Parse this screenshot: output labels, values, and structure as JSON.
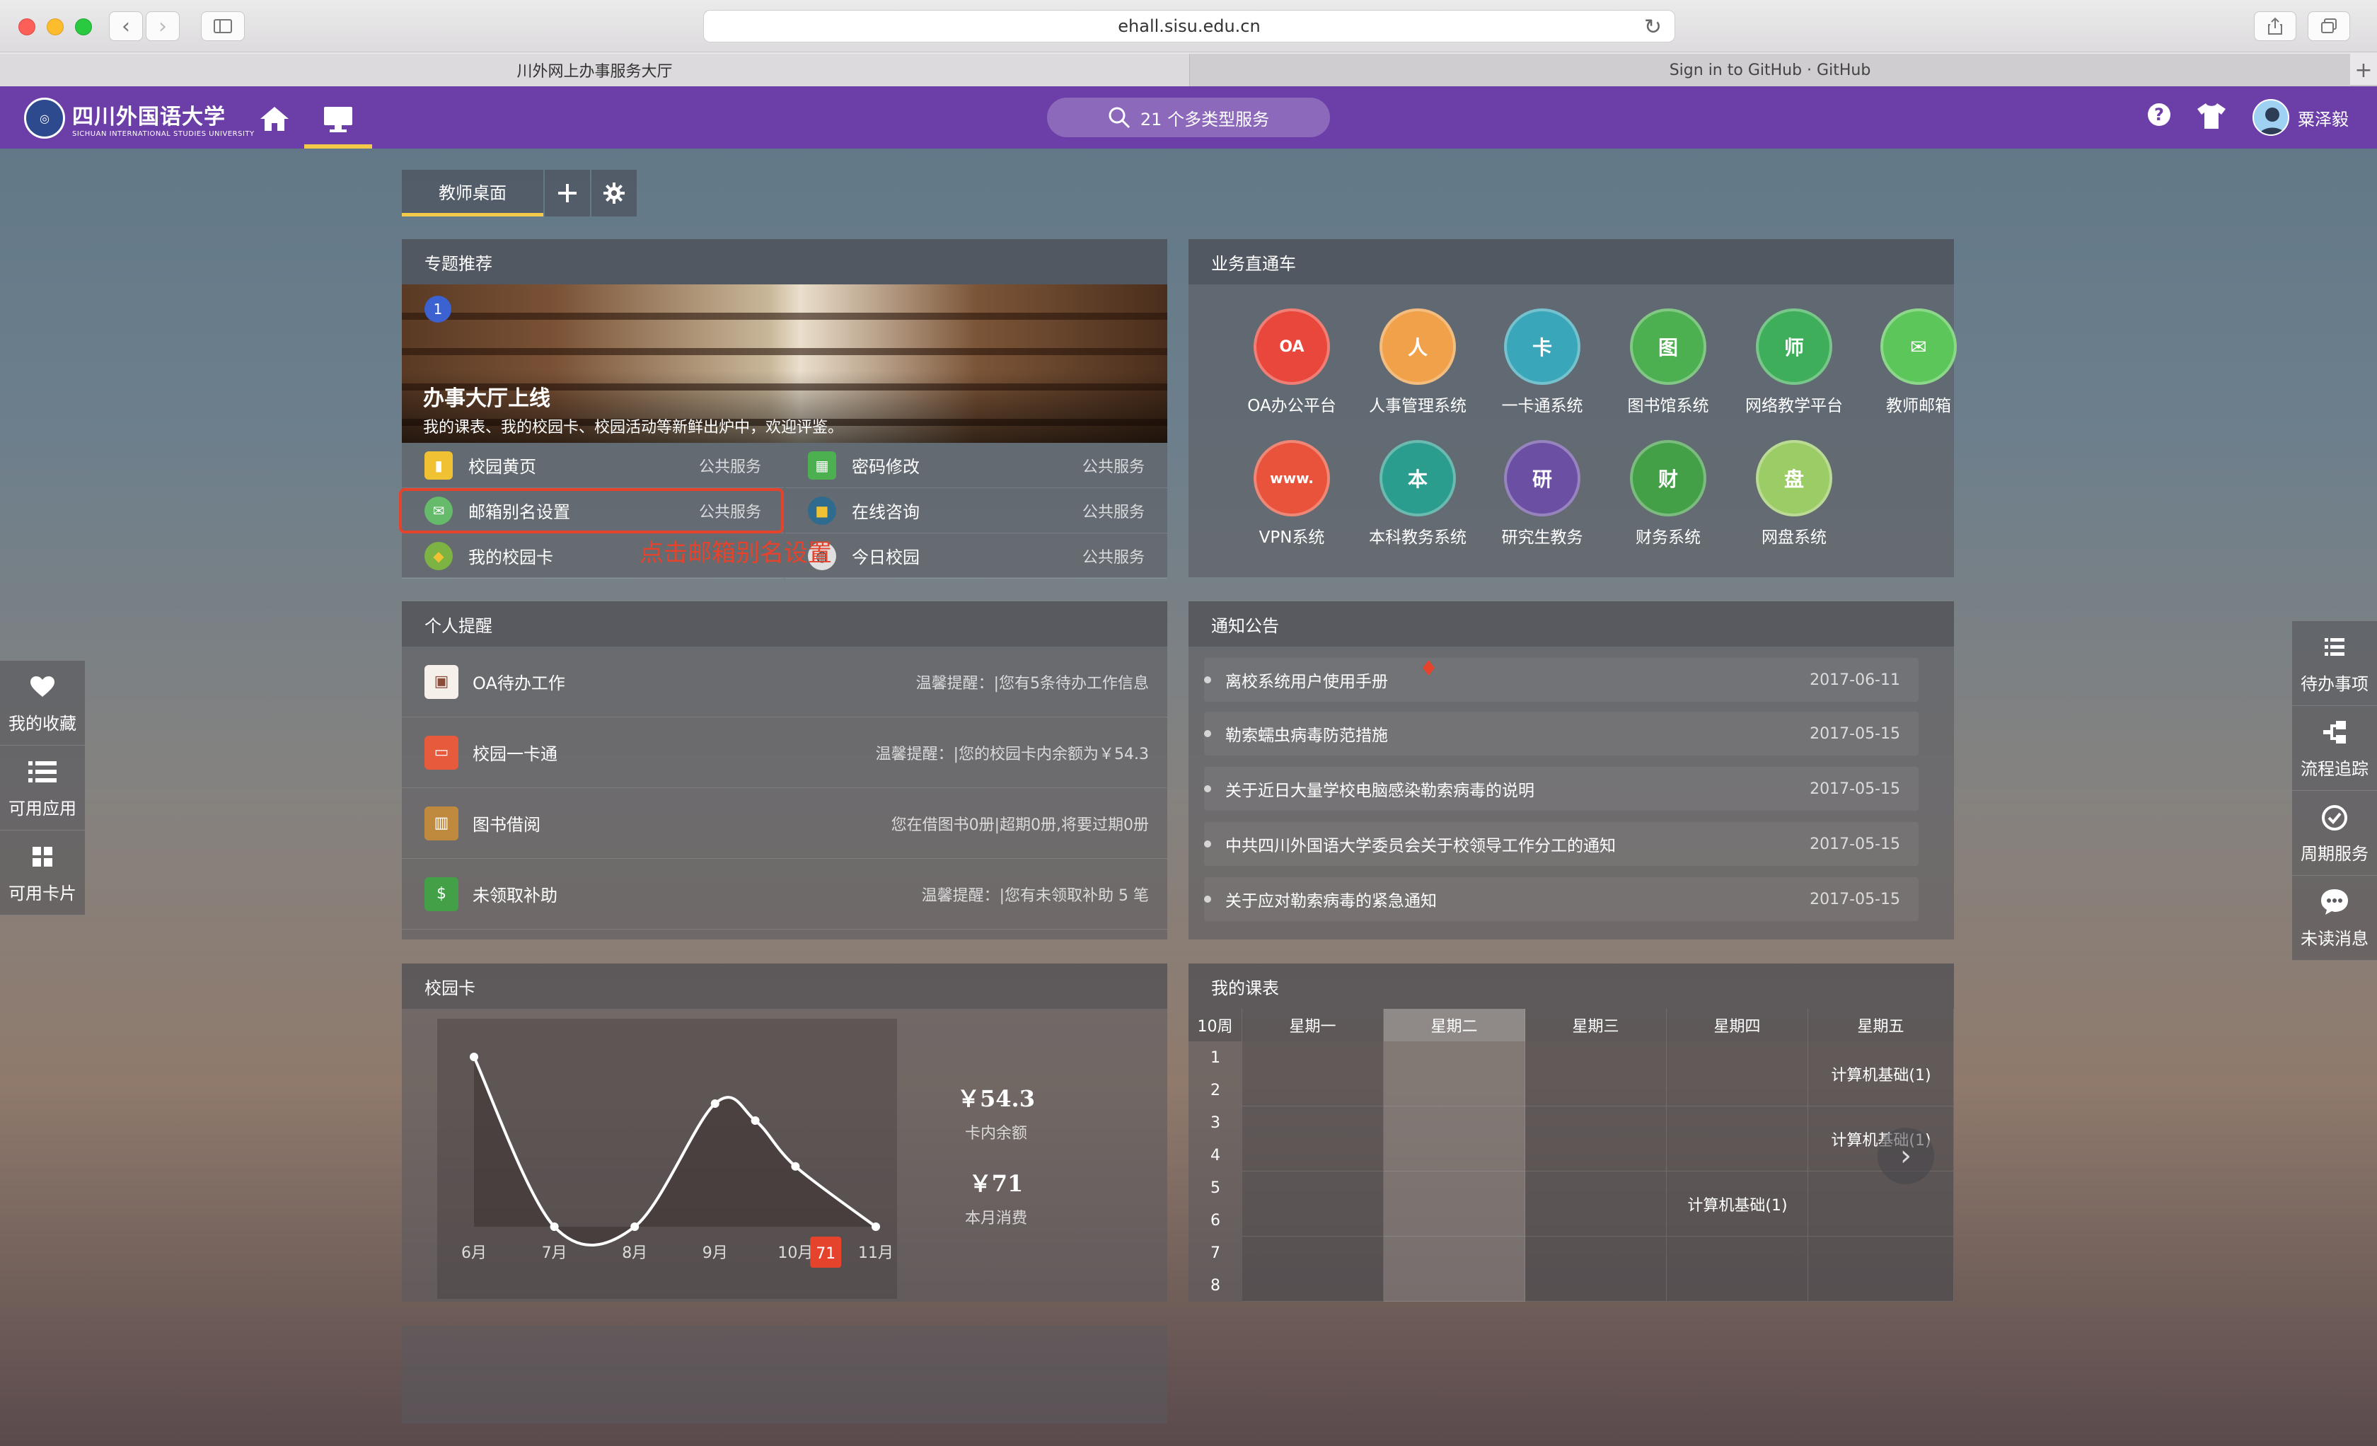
{
  "browser": {
    "url": "ehall.sisu.edu.cn",
    "tabs": [
      {
        "label": "川外网上办事服务大厅"
      },
      {
        "label": "Sign in to GitHub · GitHub"
      }
    ]
  },
  "header": {
    "logo_cn": "四川外国语大学",
    "logo_en": "SICHUAN INTERNATIONAL STUDIES UNIVERSITY",
    "search_label": "21 个多类型服务",
    "user_name": "粟泽毅",
    "accent": "#6c3fa8",
    "active_indicator": "#f3c94a"
  },
  "desktop": {
    "tab_label": "教师桌面"
  },
  "topics": {
    "title": "专题推荐",
    "banner": {
      "index": "1",
      "title": "办事大厅上线",
      "subtitle": "我的课表、我的校园卡、校园活动等新鲜出炉中，欢迎评鉴。"
    },
    "services": [
      {
        "name": "校园黄页",
        "tag": "公共服务",
        "icon": "yellow-pages-icon",
        "color": "#f0c233"
      },
      {
        "name": "密码修改",
        "tag": "公共服务",
        "icon": "password-icon",
        "color": "#4caf50"
      },
      {
        "name": "邮箱别名设置",
        "tag": "公共服务",
        "icon": "mail-alias-icon",
        "color": "#66bb6a"
      },
      {
        "name": "在线咨询",
        "tag": "公共服务",
        "icon": "chat-icon",
        "color": "#2e6b8f"
      },
      {
        "name": "我的校园卡",
        "tag": "",
        "icon": "campus-card-icon",
        "color": "#7cb342"
      },
      {
        "name": "今日校园",
        "tag": "公共服务",
        "icon": "today-campus-icon",
        "color": "#e0e0e0"
      }
    ],
    "annotation": "点击邮箱别名设置"
  },
  "business": {
    "title": "业务直通车",
    "apps": [
      {
        "name": "OA办公平台",
        "icon": "oa-icon",
        "color": "#e9473b",
        "glyph": "OA"
      },
      {
        "name": "人事管理系统",
        "icon": "hr-icon",
        "color": "#f0a14a",
        "glyph": "人"
      },
      {
        "name": "一卡通系统",
        "icon": "card-system-icon",
        "color": "#3aa6b9",
        "glyph": "卡"
      },
      {
        "name": "图书馆系统",
        "icon": "library-icon",
        "color": "#4caf50",
        "glyph": "图"
      },
      {
        "name": "网络教学平台",
        "icon": "teaching-platform-icon",
        "color": "#3fae5a",
        "glyph": "师"
      },
      {
        "name": "教师邮箱",
        "icon": "teacher-mail-icon",
        "color": "#5cc65a",
        "glyph": "✉"
      },
      {
        "name": "VPN系统",
        "icon": "vpn-icon",
        "color": "#e9533b",
        "glyph": "www."
      },
      {
        "name": "本科教务系统",
        "icon": "undergrad-affairs-icon",
        "color": "#2a9d8f",
        "glyph": "本"
      },
      {
        "name": "研究生教务",
        "icon": "graduate-affairs-icon",
        "color": "#6a4fa3",
        "glyph": "研"
      },
      {
        "name": "财务系统",
        "icon": "finance-icon",
        "color": "#43a047",
        "glyph": "财"
      },
      {
        "name": "网盘系统",
        "icon": "cloud-disk-icon",
        "color": "#9ccc65",
        "glyph": "盘"
      }
    ]
  },
  "reminders": {
    "title": "个人提醒",
    "items": [
      {
        "name": "OA待办工作",
        "tip": "温馨提醒：|您有5条待办工作信息",
        "icon": "oa-todo-icon",
        "color": "#8d4b3a"
      },
      {
        "name": "校园一卡通",
        "tip": "温馨提醒：|您的校园卡内余额为￥54.3",
        "icon": "card-icon",
        "color": "#e85a3c"
      },
      {
        "name": "图书借阅",
        "tip": "您在借图书0册|超期0册,将要过期0册",
        "icon": "books-icon",
        "color": "#c08a3e"
      },
      {
        "name": "未领取补助",
        "tip": "温馨提醒：|您有未领取补助 5 笔",
        "icon": "subsidy-icon",
        "color": "#43a047"
      }
    ]
  },
  "notices": {
    "title": "通知公告",
    "items": [
      {
        "title": "离校系统用户使用手册",
        "date": "2017-06-11"
      },
      {
        "title": "勒索蠕虫病毒防范措施",
        "date": "2017-05-15"
      },
      {
        "title": "关于近日大量学校电脑感染勒索病毒的说明",
        "date": "2017-05-15"
      },
      {
        "title": "中共四川外国语大学委员会关于校领导工作分工的通知",
        "date": "2017-05-15"
      },
      {
        "title": "关于应对勒索病毒的紧急通知",
        "date": "2017-05-15"
      }
    ]
  },
  "campus_card": {
    "title": "校园卡",
    "balance": "￥54.3",
    "balance_label": "卡内余额",
    "monthly": "￥71",
    "monthly_label": "本月消费",
    "current_badge": "71",
    "chart_data": {
      "type": "line",
      "categories": [
        "6月",
        "7月",
        "8月",
        "9月",
        "10月",
        "11月"
      ],
      "x": [
        6,
        7,
        8,
        9,
        9.5,
        10,
        11
      ],
      "values": [
        200,
        0,
        0,
        145,
        125,
        71,
        0
      ],
      "ylim": [
        0,
        210
      ],
      "highlight": {
        "category": "10月",
        "value": 71
      },
      "color": "#ffffff"
    }
  },
  "timetable": {
    "title": "我的课表",
    "week": "10周",
    "days": [
      "星期一",
      "星期二",
      "星期三",
      "星期四",
      "星期五"
    ],
    "today_index": 1,
    "periods": [
      "1",
      "2",
      "3",
      "4",
      "5",
      "6",
      "7",
      "8"
    ],
    "courses": [
      {
        "name": "计算机基础(1)",
        "day": 4,
        "block": 0
      },
      {
        "name": "计算机基础(1)",
        "day": 4,
        "block": 1
      },
      {
        "name": "计算机基础(1)",
        "day": 3,
        "block": 2
      }
    ]
  },
  "left_sidebar": [
    {
      "label": "我的收藏",
      "icon": "heart-icon"
    },
    {
      "label": "可用应用",
      "icon": "list-icon"
    },
    {
      "label": "可用卡片",
      "icon": "grid-icon"
    }
  ],
  "right_sidebar": [
    {
      "label": "待办事项",
      "icon": "todo-list-icon"
    },
    {
      "label": "流程追踪",
      "icon": "flow-icon"
    },
    {
      "label": "周期服务",
      "icon": "cycle-check-icon"
    },
    {
      "label": "未读消息",
      "icon": "message-icon"
    }
  ]
}
